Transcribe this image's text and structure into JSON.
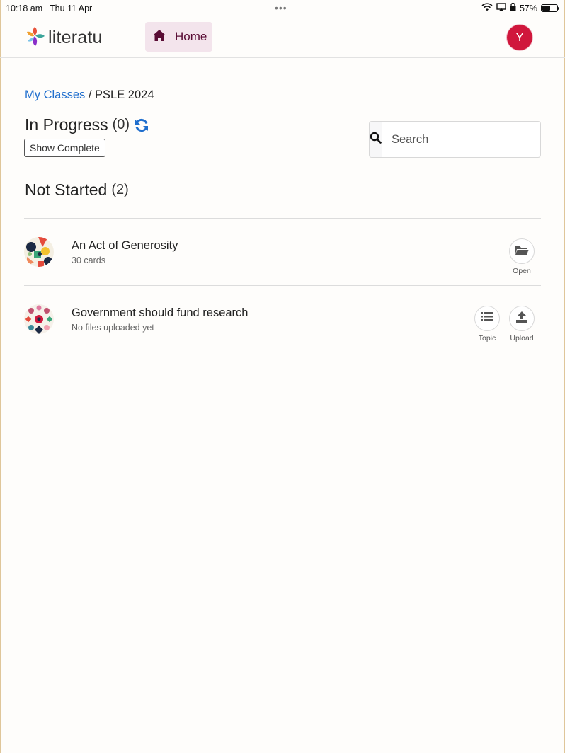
{
  "status_bar": {
    "time": "10:18 am",
    "date": "Thu 11 Apr",
    "multitask_dots": "•••",
    "battery_percent": "57%",
    "battery_level": 0.57
  },
  "header": {
    "logo_text": "literatu",
    "home_label": "Home",
    "avatar_initial": "Y"
  },
  "breadcrumb": {
    "link": "My Classes",
    "separator": " / ",
    "current": "PSLE 2024"
  },
  "in_progress": {
    "title": "In Progress",
    "count": "(0)",
    "show_complete_label": "Show Complete"
  },
  "search": {
    "placeholder": "Search",
    "value": ""
  },
  "not_started": {
    "title": "Not Started",
    "count": "(2)",
    "items": [
      {
        "title": "An Act of Generosity",
        "subtitle": "30 cards",
        "actions": [
          {
            "label": "Open",
            "icon": "folder-open-icon"
          }
        ]
      },
      {
        "title": "Government should fund research",
        "subtitle": "No files uploaded yet",
        "actions": [
          {
            "label": "Topic",
            "icon": "list-icon"
          },
          {
            "label": "Upload",
            "icon": "upload-icon"
          }
        ]
      }
    ]
  },
  "colors": {
    "brand_link": "#1f6ecd",
    "home_bg": "#f3e4ec",
    "home_text": "#5a0d35",
    "avatar_bg": "#d0173c"
  }
}
